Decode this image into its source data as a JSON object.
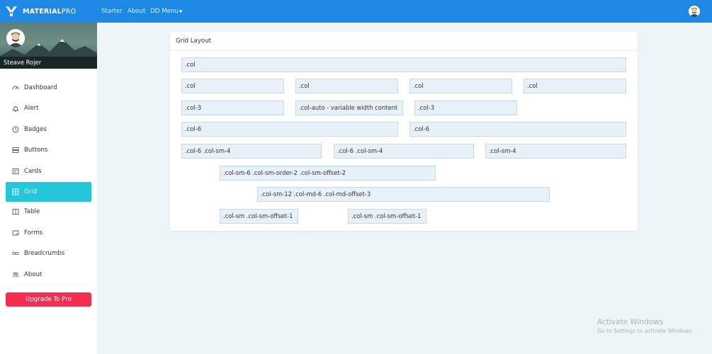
{
  "brand": {
    "bold": "MATERIAL",
    "light": "PRO"
  },
  "topnav": {
    "starter": "Starter",
    "about": "About",
    "dd_menu": "DD Menu"
  },
  "profile": {
    "name": "Steave Rojer"
  },
  "sidebar": {
    "items": [
      {
        "label": "Dashboard",
        "icon": "gauge-icon"
      },
      {
        "label": "Alert",
        "icon": "bell-icon"
      },
      {
        "label": "Badges",
        "icon": "clock-icon"
      },
      {
        "label": "Buttons",
        "icon": "server-icon"
      },
      {
        "label": "Cards",
        "icon": "card-icon"
      },
      {
        "label": "Grid",
        "icon": "grid-icon"
      },
      {
        "label": "Table",
        "icon": "table-icon"
      },
      {
        "label": "Forms",
        "icon": "forms-icon"
      },
      {
        "label": "Breadcrumbs",
        "icon": "link-icon"
      },
      {
        "label": "About",
        "icon": "users-icon"
      }
    ],
    "active": "Grid",
    "upgrade_label": "Upgrade To Pro"
  },
  "card": {
    "title": "Grid Layout",
    "cells": [
      ".col",
      ".col",
      ".col",
      ".col",
      ".col",
      ".col-3",
      ".col-auto - variable width content",
      ".col-3",
      ".col-6",
      ".col-6",
      ".col-6 .col-sm-4",
      ".col-6 .col-sm-4",
      ".col-sm-4",
      ".col-sm-6 .col-sm-order-2 .col-sm-offset-2",
      ".col-sm-12 .col-md-6 .col-md-offset-3",
      ".col-sm .col-sm-offset-1",
      ".col-sm .col-sm-offset-1"
    ]
  },
  "watermark": {
    "line1": "Activate Windows",
    "line2": "Go to Settings to activate Windows."
  },
  "colors": {
    "topbar": "#1e88e5",
    "active": "#26c6da",
    "upgrade": "#f62d51",
    "cell_bg": "#e8f0f8"
  }
}
